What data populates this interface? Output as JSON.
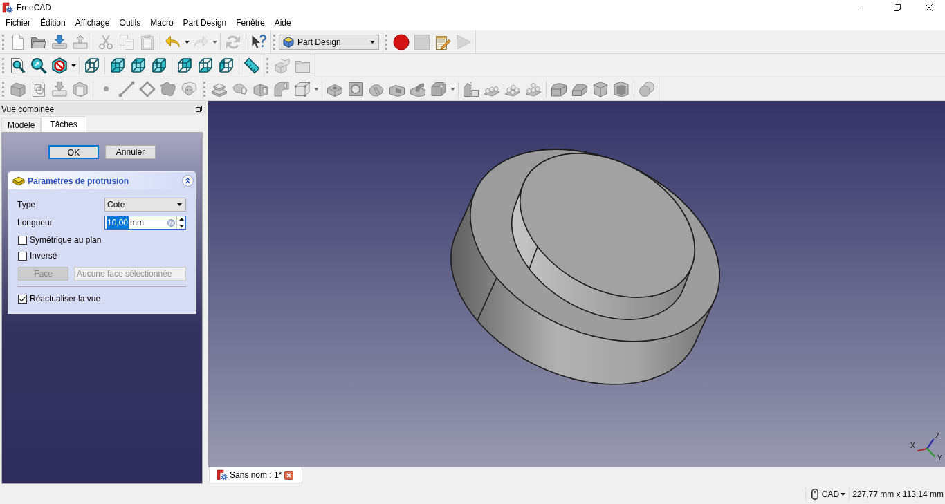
{
  "window": {
    "title": "FreeCAD"
  },
  "menu": [
    "Fichier",
    "Édition",
    "Affichage",
    "Outils",
    "Macro",
    "Part Design",
    "Fenêtre",
    "Aide"
  ],
  "toolbar_rows": [
    [
      {
        "kind": "buttons",
        "groups": [
          [
            {
              "disabled": false,
              "has_menu": false
            },
            {
              "disabled": false,
              "has_menu": false
            },
            {
              "disabled": false,
              "has_menu": false
            },
            {
              "disabled": false,
              "has_menu": false
            }
          ],
          [
            {
              "disabled": true,
              "has_menu": false
            },
            {
              "disabled": true,
              "has_menu": false
            },
            {
              "disabled": true,
              "has_menu": false
            }
          ],
          [
            {
              "disabled": false,
              "has_menu": true
            },
            {
              "disabled": true,
              "has_menu": true
            }
          ],
          [
            {
              "disabled": true,
              "has_menu": false
            }
          ],
          [
            {
              "disabled": false,
              "has_menu": false
            }
          ]
        ]
      },
      {
        "kind": "combo",
        "value": "Part Design"
      },
      {
        "kind": "buttons",
        "groups": [
          [
            {
              "disabled": false,
              "has_menu": false
            },
            {
              "disabled": true,
              "has_menu": false
            },
            {
              "disabled": false,
              "has_menu": false
            },
            {
              "disabled": true,
              "has_menu": false
            }
          ]
        ]
      }
    ],
    [
      {
        "kind": "buttons",
        "groups": [
          [
            {
              "disabled": false,
              "has_menu": false
            },
            {
              "disabled": false,
              "has_menu": false
            },
            {
              "disabled": false,
              "has_menu": true
            }
          ],
          [
            {
              "disabled": false,
              "has_menu": false
            }
          ],
          [
            {
              "disabled": false,
              "has_menu": false
            },
            {
              "disabled": false,
              "has_menu": false
            },
            {
              "disabled": false,
              "has_menu": false
            }
          ],
          [
            {
              "disabled": false,
              "has_menu": false
            },
            {
              "disabled": false,
              "has_menu": false
            },
            {
              "disabled": false,
              "has_menu": false
            }
          ],
          [
            {
              "disabled": false,
              "has_menu": false
            }
          ]
        ]
      },
      {
        "kind": "buttons",
        "groups": [
          [
            {
              "disabled": true,
              "has_menu": false
            },
            {
              "disabled": true,
              "has_menu": false
            }
          ]
        ]
      }
    ],
    [
      {
        "kind": "buttons",
        "groups": [
          [
            {
              "disabled": true,
              "has_menu": false
            },
            {
              "disabled": true,
              "has_menu": false
            },
            {
              "disabled": true,
              "has_menu": false
            },
            {
              "disabled": true,
              "has_menu": false
            }
          ],
          [
            {
              "disabled": true,
              "has_menu": false
            },
            {
              "disabled": true,
              "has_menu": false
            },
            {
              "disabled": true,
              "has_menu": false
            },
            {
              "disabled": true,
              "has_menu": false
            },
            {
              "disabled": true,
              "has_menu": false
            }
          ]
        ]
      },
      {
        "kind": "buttons",
        "groups": [
          [
            {
              "disabled": true,
              "has_menu": false
            },
            {
              "disabled": true,
              "has_menu": false
            },
            {
              "disabled": true,
              "has_menu": false
            },
            {
              "disabled": true,
              "has_menu": false
            },
            {
              "disabled": true,
              "has_menu": true
            }
          ],
          [
            {
              "disabled": true,
              "has_menu": false
            },
            {
              "disabled": true,
              "has_menu": false
            },
            {
              "disabled": true,
              "has_menu": false
            },
            {
              "disabled": true,
              "has_menu": false
            },
            {
              "disabled": true,
              "has_menu": false
            },
            {
              "disabled": true,
              "has_menu": true
            }
          ],
          [
            {
              "disabled": true,
              "has_menu": false
            },
            {
              "disabled": true,
              "has_menu": false
            },
            {
              "disabled": true,
              "has_menu": false
            },
            {
              "disabled": true,
              "has_menu": false
            }
          ],
          [
            {
              "disabled": true,
              "has_menu": false
            },
            {
              "disabled": true,
              "has_menu": false
            },
            {
              "disabled": true,
              "has_menu": false
            },
            {
              "disabled": true,
              "has_menu": false
            }
          ],
          [
            {
              "disabled": true,
              "has_menu": false
            }
          ]
        ]
      }
    ]
  ],
  "dock": {
    "title": "Vue combinée",
    "tabs": [
      {
        "label": "Modèle",
        "selected": false
      },
      {
        "label": "Tâches",
        "selected": true
      }
    ],
    "task": {
      "buttons": [
        {
          "label": "OK",
          "default": true
        },
        {
          "label": "Annuler",
          "default": false
        }
      ],
      "section": {
        "title": "Paramètres de protrusion",
        "expanded": true,
        "type": {
          "label": "Type",
          "value": "Cote"
        },
        "length": {
          "label": "Longueur",
          "value": "10,00",
          "unit": "mm",
          "value_selected": true
        },
        "options": [
          {
            "label": "Symétrique au plan",
            "checked": false
          },
          {
            "label": "Inversé",
            "checked": false
          }
        ],
        "face": {
          "button": "Face",
          "field": "Aucune face sélectionnée",
          "disabled": true
        },
        "refresh": {
          "label": "Réactualiser la vue",
          "checked": true
        }
      }
    }
  },
  "view": {
    "axis_triad": {
      "x": "X",
      "y": "Y",
      "z": "Z"
    }
  },
  "documents": [
    {
      "label": "Sans nom : 1*",
      "selected": true
    }
  ],
  "status_bar": {
    "navigation": "CAD",
    "dimensions": "227,77 mm x 113,14 mm"
  }
}
